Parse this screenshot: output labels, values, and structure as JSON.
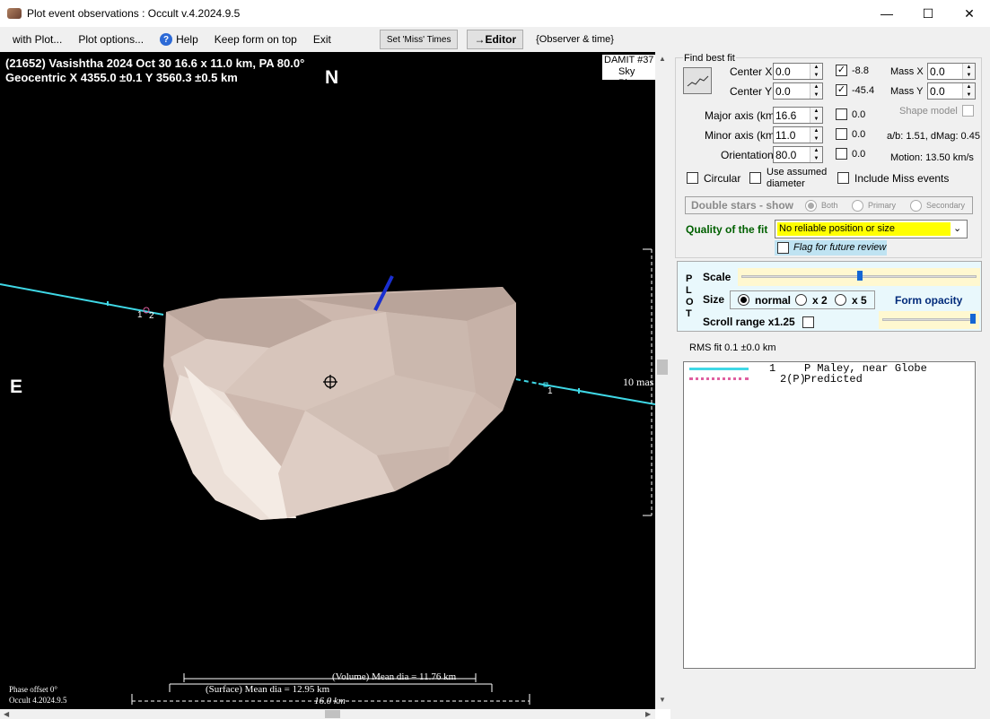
{
  "window": {
    "title": "Plot event observations : Occult v.4.2024.9.5",
    "minimize": "—",
    "maximize": "☐",
    "close": "✕"
  },
  "menu": {
    "items": [
      "with Plot...",
      "Plot options...",
      "Help",
      "Keep form on top",
      "Exit"
    ],
    "set_miss_times": "Set 'Miss' Times",
    "editor": "→Editor",
    "observer_time": "{Observer & time}"
  },
  "plot": {
    "header_line1": "(21652) Vasishtha  2024 Oct 30   16.6 x 11.0 km, PA 80.0°",
    "header_line2": "Geocentric  X  4355.0 ±0.1  Y 3560.3 ±0.5 km",
    "north": "N",
    "east": "E",
    "damit": "DAMIT #37",
    "sky_plane": "Sky Plan",
    "scale_mas": "10 mas",
    "chord1_labels": [
      "1",
      "2"
    ],
    "chord_right_label": "1",
    "volume_dia": "(Volume) Mean dia = 11.76 km",
    "surface_dia": "(Surface) Mean dia = 12.95 km",
    "km_scale": "16.0 km",
    "phase_offset": "Phase offset 0°",
    "version": "Occult 4.2024.9.5"
  },
  "panel": {
    "find_best_fit": "Find best fit",
    "center_x_label": "Center X",
    "center_x": "0.0",
    "center_y_label": "Center Y",
    "center_y": "0.0",
    "center_x_check": "-8.8",
    "center_y_check": "-45.4",
    "mass_x_label": "Mass X",
    "mass_x": "0.0",
    "mass_y_label": "Mass Y",
    "mass_y": "0.0",
    "major_label": "Major axis (km)",
    "major": "16.6",
    "minor_label": "Minor axis (km)",
    "minor": "11.0",
    "orient_label": "Orientation",
    "orient": "80.0",
    "major_check": "0.0",
    "minor_check": "0.0",
    "orient_check": "0.0",
    "shape_model": "Shape model",
    "ab_dmag": "a/b: 1.51, dMag: 0.45",
    "motion": "Motion: 13.50 km/s",
    "circular": "Circular",
    "use_assumed": "Use assumed",
    "diameter": "diameter",
    "include_miss": "Include Miss events",
    "double_stars": "Double stars - show",
    "both": "Both",
    "primary": "Primary",
    "secondary": "Secondary",
    "quality_label": "Quality of the fit",
    "quality_value": "No reliable position or size",
    "flag_review": "Flag for future review",
    "plot_vertical": [
      "P",
      "L",
      "O",
      "T"
    ],
    "scale_label": "Scale",
    "size_label": "Size",
    "size_normal": "normal",
    "size_x2": "x 2",
    "size_x5": "x 5",
    "form_opacity": "Form opacity",
    "scroll_range": "Scroll range x1.25",
    "rms_fit": "RMS fit 0.1 ±0.0 km",
    "legend": [
      {
        "num": "1",
        "text": "P Maley, near Globe"
      },
      {
        "num": "2(P)",
        "text": "Predicted"
      }
    ]
  },
  "colors": {
    "chord": "#3fd8e6",
    "predicted": "#e060a0",
    "asteroid": "#d8c6bc",
    "quality_bg": "#ffff00",
    "flag_bg": "#bfe3f2"
  }
}
